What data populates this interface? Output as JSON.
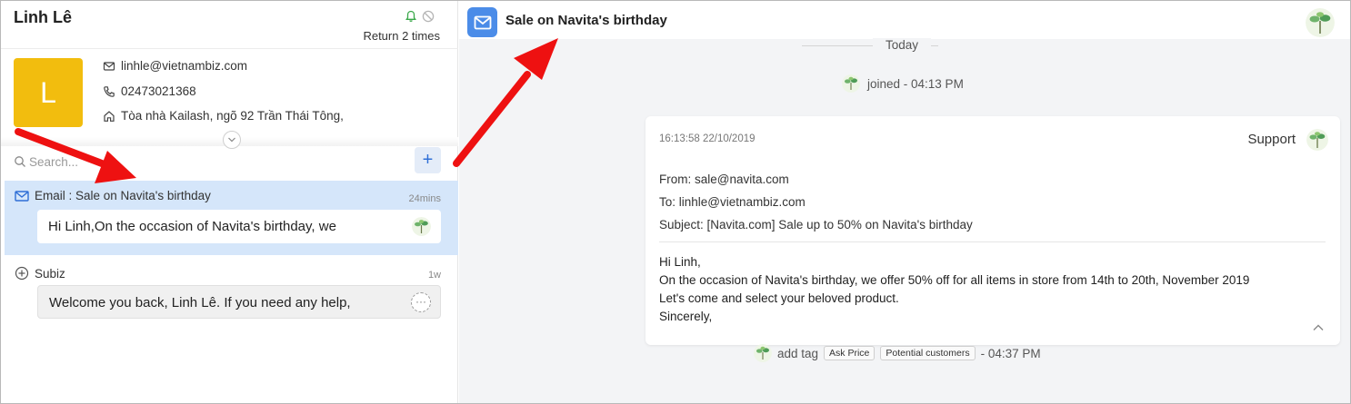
{
  "contact": {
    "name": "Linh Lê",
    "avatar_letter": "L",
    "return_text": "Return 2 times",
    "email": "linhle@vietnambiz.com",
    "phone": "02473021368",
    "address": "Tòa nhà Kailash, ngõ 92 Trần Thái Tông,"
  },
  "search": {
    "placeholder": "Search..."
  },
  "add_button": {
    "label": "+"
  },
  "conversations": [
    {
      "title": "Email : Sale on Navita's birthday",
      "time": "24mins",
      "preview": "Hi Linh,On the occasion of Navita's birthday, we",
      "icon": "mail-icon"
    },
    {
      "title": "Subiz",
      "time": "1w",
      "preview": "Welcome you back, Linh Lê. If you need any help,",
      "icon": "plus-circle-icon",
      "more_label": "···"
    }
  ],
  "header": {
    "title": "Sale on Navita's birthday"
  },
  "timeline": {
    "date_label": "Today",
    "joined": "joined - 04:13 PM"
  },
  "email": {
    "timestamp": "16:13:58 22/10/2019",
    "sender": "Support",
    "from": "From: sale@navita.com",
    "to": "To: linhle@vietnambiz.com",
    "subject": "Subject: [Navita.com] Sale up to 50% on Navita's birthday",
    "body": [
      "Hi Linh,",
      "On the occasion of Navita's birthday, we offer 50% off for all items in store from 14th to 20th, November 2019",
      "Let's come and select your beloved product.",
      "Sincerely,"
    ]
  },
  "tags": {
    "prefix": "add tag",
    "items": [
      "Ask Price",
      "Potential customers"
    ],
    "time": "- 04:37 PM"
  },
  "colors": {
    "accent": "#4b8ce8",
    "selected_bg": "#d5e6fa",
    "avatar_tile": "#f2bd0e",
    "annotation_arrow": "#ee1111"
  }
}
